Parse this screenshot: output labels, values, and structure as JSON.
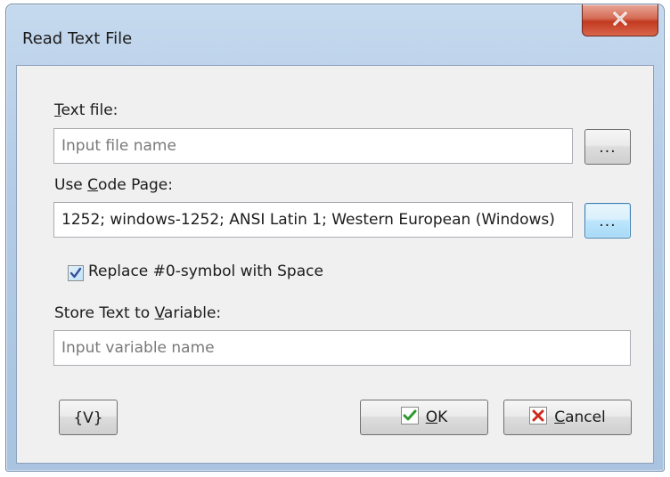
{
  "window": {
    "title": "Read Text File"
  },
  "text_file": {
    "label_accel": "T",
    "label_rest": "ext file:",
    "placeholder": "Input file name"
  },
  "code_page": {
    "label_pre": "Use ",
    "label_accel": "C",
    "label_rest": "ode Page:",
    "value": "1252; windows-1252; ANSI Latin 1; Western European (Windows)"
  },
  "browse_label": "...",
  "replace_option": {
    "label": "Replace #0-symbol with Space",
    "checked": true
  },
  "store_variable": {
    "label_pre": "Store Text to ",
    "label_accel": "V",
    "label_rest": "ariable:",
    "placeholder": "Input variable name"
  },
  "buttons": {
    "variables": "{V}",
    "ok_accel": "O",
    "ok_rest": "K",
    "cancel_accel": "C",
    "cancel_rest": "ancel"
  },
  "icons": {
    "close": "close-icon",
    "ok": "checkmark-icon",
    "cancel": "x-mark-icon",
    "check": "check-icon"
  },
  "colors": {
    "ok_icon": "#2e9a2e",
    "cancel_icon": "#d02a1e",
    "close_button": "#c23a20"
  }
}
